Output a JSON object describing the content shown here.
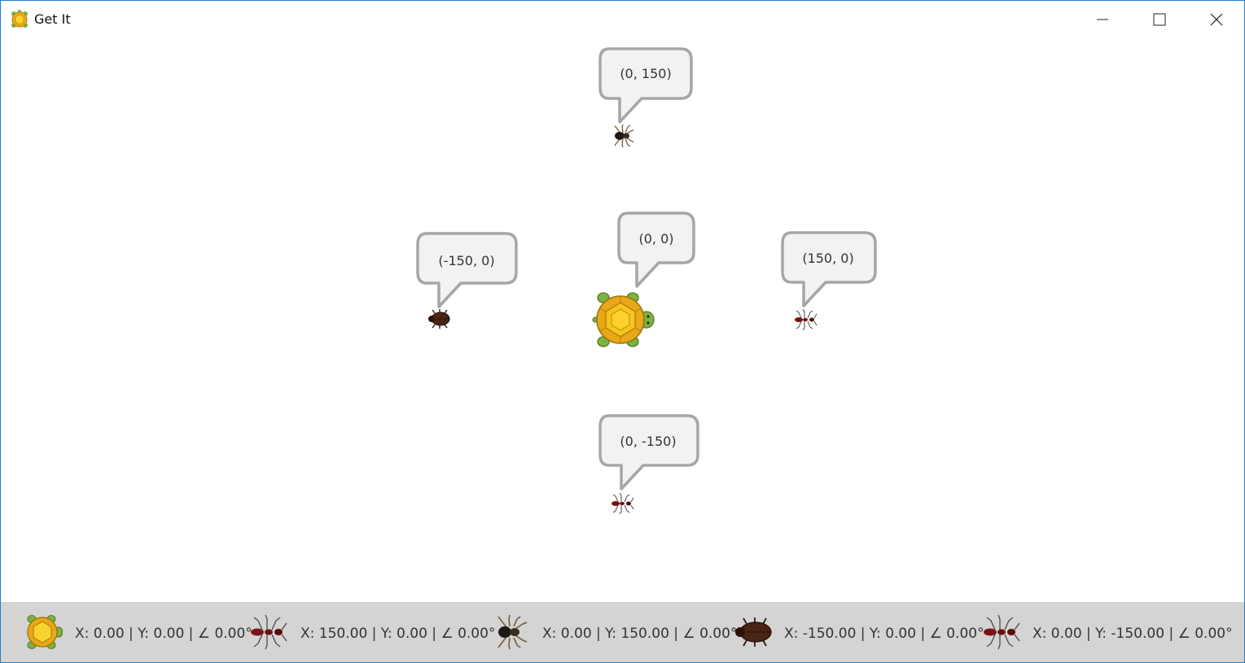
{
  "window": {
    "title": "Get It",
    "controls": {
      "minimize": "minimize-icon",
      "maximize": "maximize-icon",
      "close": "close-icon"
    }
  },
  "stage": {
    "turtle": {
      "icon": "turtle-icon",
      "label": "(0, 0)"
    },
    "sprites": [
      {
        "icon": "spider-icon",
        "label": "(0, 150)"
      },
      {
        "icon": "beetle-icon",
        "label": "(-150, 0)"
      },
      {
        "icon": "ant-icon",
        "label": "(150, 0)"
      },
      {
        "icon": "ant-icon",
        "label": "(0, -150)"
      }
    ]
  },
  "statusbar": {
    "items": [
      {
        "icon": "turtle-icon",
        "text": "X: 0.00 | Y: 0.00 | ∠ 0.00°"
      },
      {
        "icon": "ant-icon",
        "text": "X: 150.00 | Y: 0.00 | ∠ 0.00°"
      },
      {
        "icon": "spider-icon",
        "text": "X: 0.00 | Y: 150.00 | ∠ 0.00°"
      },
      {
        "icon": "beetle-icon",
        "text": "X: -150.00 | Y: 0.00 | ∠ 0.00°"
      },
      {
        "icon": "ant-icon",
        "text": "X: 0.00 | Y: -150.00 | ∠ 0.00°"
      }
    ]
  },
  "colors": {
    "window_border": "#1b7fd1",
    "statusbar_bg": "#d4d4d4",
    "bubble_fill": "#f2f2f2",
    "bubble_stroke": "#a6a6a6",
    "turtle_shell": "#f2c218",
    "turtle_body": "#7cb342"
  }
}
